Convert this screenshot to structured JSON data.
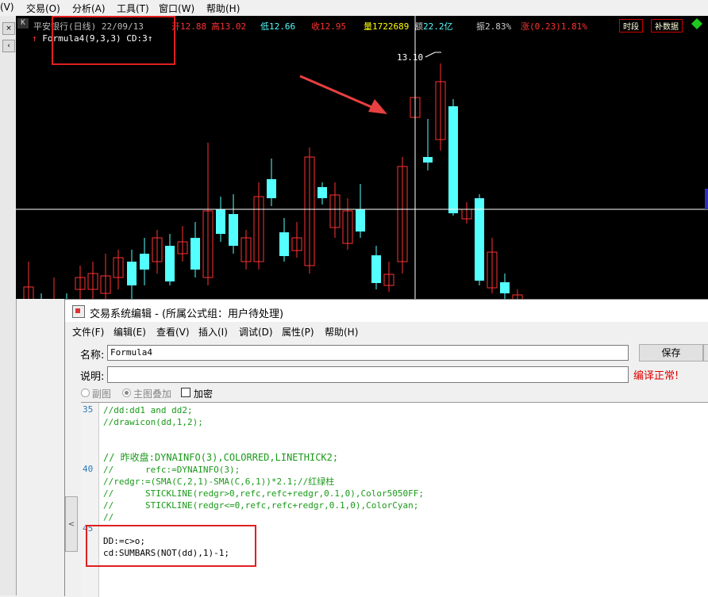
{
  "menubar": {
    "items": [
      "(V)",
      "交易(O)",
      "分析(A)",
      "工具(T)",
      "窗口(W)",
      "帮助(H)"
    ]
  },
  "chart_header": {
    "title": "平安银行(日线) 22/09/13",
    "open": "12.88",
    "high": "13.02",
    "low": "12.66",
    "close": "12.95",
    "volume": "1722689",
    "amount": "22.2亿",
    "amplitude": "2.83%",
    "change": "(0.23)1.81%",
    "btn_period": "时段",
    "btn_fill": "补数据",
    "label_open": "开",
    "label_high": "高",
    "label_low": "低",
    "label_close": "收",
    "label_vol": "量",
    "label_amt": "额",
    "label_amp": "振",
    "label_chg": "涨"
  },
  "chart": {
    "formula_label": "Formula4(9,3,3)",
    "cd_label": "CD:3",
    "high_marker": "13.10",
    "colors": {
      "up": "#ff3232",
      "down": "#54ffff",
      "crosshair": "#ffffff",
      "arrow": "#e84040"
    }
  },
  "dialog": {
    "title": "交易系统编辑 - (所属公式组：用户待处理)",
    "menu": [
      "文件(F)",
      "编辑(E)",
      "查看(V)",
      "插入(I)",
      "调试(D)",
      "属性(P)",
      "帮助(H)"
    ],
    "name_label": "名称:",
    "name_value": "Formula4",
    "desc_label": "说明:",
    "desc_value": "",
    "save_button": "保存",
    "compile_status": "编译正常!",
    "radio_sub": "副图",
    "radio_main": "主图叠加",
    "encrypt_label": "加密",
    "scroll_left": "<"
  },
  "editor": {
    "line_numbers": [
      "35",
      "40",
      "45"
    ],
    "lines": [
      "//dd:dd1 and dd2;",
      "//drawicon(dd,1,2);",
      "",
      "",
      "// 昨收盘:DYNAINFO(3),COLORRED,LINETHICK2;",
      "//      refc:=DYNAINFO(3);",
      "//redgr:=(SMA(C,2,1)-SMA(C,6,1))*2.1;//红绿柱",
      "//      STICKLINE(redgr>0,refc,refc+redgr,0.1,0),Color5050FF;",
      "//      STICKLINE(redgr<=0,refc,refc+redgr,0.1,0),ColorCyan;",
      "//",
      "",
      "DD:=c>o;",
      "cd:SUMBARS(NOT(dd),1)-1;"
    ]
  }
}
